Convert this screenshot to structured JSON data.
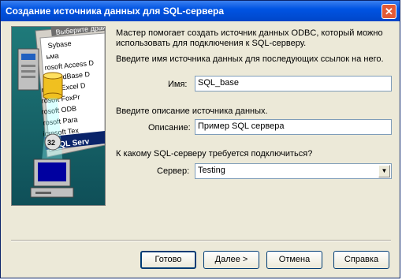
{
  "window": {
    "title": "Создание источника данных для SQL-сервера"
  },
  "art": {
    "header": "Выберите драй",
    "list": [
      "Sybase",
      "ьма",
      "rosoft Access D",
      "rosoft dBase D",
      "rosoft Excel D",
      "rosoft FoxPr",
      "rosoft ODB",
      "rosoft Para",
      "icrosoft Tex",
      "SQL Serv"
    ],
    "badge": "32"
  },
  "intro": "Мастер помогает создать источник данных ODBC, который можно использовать для подключения к SQL-серверу.",
  "name_prompt": "Введите имя источника данных для последующих ссылок на него.",
  "name_label": "Имя:",
  "name_value": "SQL_base",
  "desc_prompt": "Введите описание источника данных.",
  "desc_label": "Описание:",
  "desc_value": "Пример SQL сервера",
  "server_prompt": "К какому SQL-серверу требуется подключиться?",
  "server_label": "Сервер:",
  "server_value": "Testing",
  "buttons": {
    "finish": "Готово",
    "next": "Далее >",
    "cancel": "Отмена",
    "help": "Справка"
  },
  "colors": {
    "title_bar": "#0054e3",
    "dialog_bg": "#ece9d8"
  }
}
